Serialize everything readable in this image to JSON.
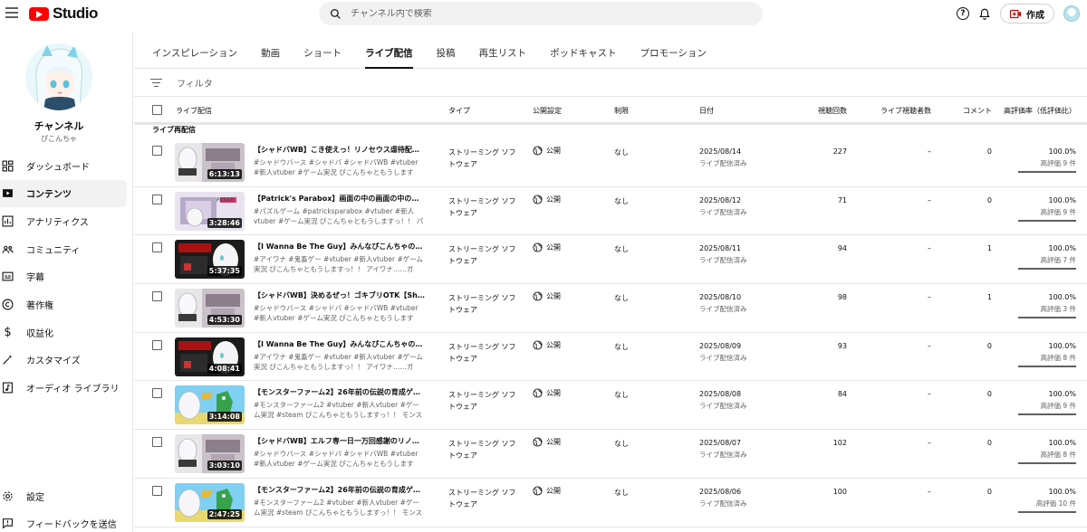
{
  "header": {
    "logo_text": "Studio",
    "search_placeholder": "チャンネル内で検索",
    "create_label": "作成"
  },
  "channel": {
    "title": "チャンネル",
    "handle": "ぴこんちゃ"
  },
  "sidebar": {
    "items": [
      {
        "label": "ダッシュボード",
        "icon": "dashboard-icon"
      },
      {
        "label": "コンテンツ",
        "icon": "content-icon",
        "active": true
      },
      {
        "label": "アナリティクス",
        "icon": "analytics-icon"
      },
      {
        "label": "コミュニティ",
        "icon": "community-icon"
      },
      {
        "label": "字幕",
        "icon": "subtitles-icon"
      },
      {
        "label": "著作権",
        "icon": "copyright-icon"
      },
      {
        "label": "収益化",
        "icon": "dollar-icon"
      },
      {
        "label": "カスタマイズ",
        "icon": "magic-wand-icon"
      },
      {
        "label": "オーディオ ライブラリ",
        "icon": "audio-library-icon"
      }
    ],
    "bottom_items": [
      {
        "label": "設定",
        "icon": "gear-icon"
      },
      {
        "label": "フィードバックを送信",
        "icon": "feedback-icon"
      }
    ]
  },
  "tabs": [
    "インスピレーション",
    "動画",
    "ショート",
    "ライブ配信",
    "投稿",
    "再生リスト",
    "ポッドキャスト",
    "プロモーション"
  ],
  "active_tab": "ライブ配信",
  "filter_placeholder": "フィルタ",
  "columns": {
    "video": "ライブ配信",
    "type": "タイプ",
    "visibility": "公開設定",
    "restrictions": "制限",
    "date": "日付",
    "views": "視聴回数",
    "live_viewers": "ライブ視聴者数",
    "comments": "コメント",
    "likes": "高評価率（低評価比）"
  },
  "section_label": "ライブ再配信",
  "rows": [
    {
      "title": "【シャドバWB】こき使えっ！リノセウス虐待配…",
      "desc": "#シャドウバース #シャドバ #シャドバWB #vtuber #新人vtuber #ゲーム実況 ぴこんちゃともうしますっ…",
      "duration": "6:13:13",
      "type": "ストリーミング ソフトウェア",
      "visibility": "公開",
      "restrictions": "なし",
      "date": "2025/08/14",
      "date_sub": "ライブ配信済み",
      "views": "227",
      "live_viewers": "–",
      "comments": "0",
      "like_pct": "100.0%",
      "likes": "高評価 9 件",
      "like_ratio": 1.0,
      "thumb_style": "shadow"
    },
    {
      "title": "【Patrick's Parabox】画面の中の画面の中の画面…",
      "desc": "#パズルゲーム #patricksparabox #vtuber #新人vtuber #ゲーム実況 ぴこんちゃともうしますっ！！ パズル…",
      "duration": "3:28:46",
      "type": "ストリーミング ソフトウェア",
      "visibility": "公開",
      "restrictions": "なし",
      "date": "2025/08/12",
      "date_sub": "ライブ配信済み",
      "views": "71",
      "live_viewers": "–",
      "comments": "0",
      "like_pct": "100.0%",
      "likes": "高評価 9 件",
      "like_ratio": 1.0,
      "thumb_style": "parabox"
    },
    {
      "title": "【I Wanna Be The Guy】みんなぴこんちゃの苦し…",
      "desc": "#アイワナ #鬼畜ゲー #vtuber #新人vtuber #ゲーム実況 ぴこんちゃともうしますっ！！ アイワナ……ガチ…",
      "duration": "5:37:35",
      "type": "ストリーミング ソフトウェア",
      "visibility": "公開",
      "restrictions": "なし",
      "date": "2025/08/11",
      "date_sub": "ライブ配信済み",
      "views": "94",
      "live_viewers": "–",
      "comments": "1",
      "like_pct": "100.0%",
      "likes": "高評価 7 件",
      "like_ratio": 1.0,
      "thumb_style": "iwanna"
    },
    {
      "title": "【シャドバWB】決めるぜっ！ゴキブリOTK【Sh…",
      "desc": "#シャドウバース #シャドバ #シャドバWB #vtuber #新人vtuber #ゲーム実況 ぴこんちゃともうしますっ…",
      "duration": "4:53:30",
      "type": "ストリーミング ソフトウェア",
      "visibility": "公開",
      "restrictions": "なし",
      "date": "2025/08/10",
      "date_sub": "ライブ配信済み",
      "views": "98",
      "live_viewers": "–",
      "comments": "1",
      "like_pct": "100.0%",
      "likes": "高評価 3 件",
      "like_ratio": 1.0,
      "thumb_style": "shadow"
    },
    {
      "title": "【I Wanna Be The Guy】みんなぴこんちゃの苦し…",
      "desc": "#アイワナ #鬼畜ゲー #vtuber #新人vtuber #ゲーム実況 ぴこんちゃともうしますっ！！ アイワナ……ガチ…",
      "duration": "4:08:41",
      "type": "ストリーミング ソフトウェア",
      "visibility": "公開",
      "restrictions": "なし",
      "date": "2025/08/09",
      "date_sub": "ライブ配信済み",
      "views": "93",
      "live_viewers": "–",
      "comments": "0",
      "like_pct": "100.0%",
      "likes": "高評価 8 件",
      "like_ratio": 1.0,
      "thumb_style": "iwanna"
    },
    {
      "title": "【モンスターファーム2】26年前の伝説の育成ゲ…",
      "desc": "#モンスターファーム2 #vtuber #新人vtuber #ゲーム実況 #steam ぴこんちゃともうしますっ！！ モンスタ…",
      "duration": "3:14:08",
      "type": "ストリーミング ソフトウェア",
      "visibility": "公開",
      "restrictions": "なし",
      "date": "2025/08/08",
      "date_sub": "ライブ配信済み",
      "views": "84",
      "live_viewers": "–",
      "comments": "0",
      "like_pct": "100.0%",
      "likes": "高評価 9 件",
      "like_ratio": 1.0,
      "thumb_style": "monster"
    },
    {
      "title": "【シャドバWB】エルフ専一日一万回感謝のリノ…",
      "desc": "#シャドウバース #シャドバ #シャドバWB #vtuber #新人vtuber #ゲーム実況 ぴこんちゃともうしますっ…",
      "duration": "3:03:10",
      "type": "ストリーミング ソフトウェア",
      "visibility": "公開",
      "restrictions": "なし",
      "date": "2025/08/07",
      "date_sub": "ライブ配信済み",
      "views": "102",
      "live_viewers": "–",
      "comments": "0",
      "like_pct": "100.0%",
      "likes": "高評価 8 件",
      "like_ratio": 1.0,
      "thumb_style": "shadow"
    },
    {
      "title": "【モンスターファーム2】26年前の伝説の育成ゲ…",
      "desc": "#モンスターファーム2 #vtuber #新人vtuber #ゲーム実況 #steam ぴこんちゃともうしますっ！！ モンスタ…",
      "duration": "2:47:25",
      "type": "ストリーミング ソフトウェア",
      "visibility": "公開",
      "restrictions": "なし",
      "date": "2025/08/06",
      "date_sub": "ライブ配信済み",
      "views": "100",
      "live_viewers": "–",
      "comments": "0",
      "like_pct": "100.0%",
      "likes": "高評価 10 件",
      "like_ratio": 1.0,
      "thumb_style": "monster"
    }
  ]
}
